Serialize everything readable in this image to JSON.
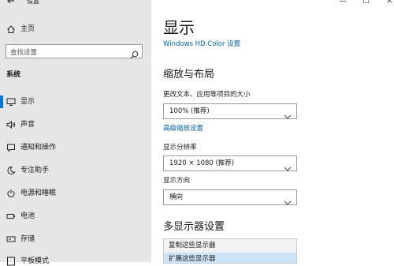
{
  "window": {
    "title": "设置",
    "controls": {
      "minimize": "—",
      "maximize": "☐",
      "close": "✕"
    }
  },
  "sidebar": {
    "home": "主页",
    "search_placeholder": "查找设置",
    "section": "系统",
    "items": [
      {
        "label": "显示",
        "icon": "monitor-icon",
        "selected": true
      },
      {
        "label": "声音",
        "icon": "speaker-icon"
      },
      {
        "label": "通知和操作",
        "icon": "notification-icon"
      },
      {
        "label": "专注助手",
        "icon": "moon-icon"
      },
      {
        "label": "电源和睡眠",
        "icon": "power-icon"
      },
      {
        "label": "电池",
        "icon": "battery-icon"
      },
      {
        "label": "存储",
        "icon": "storage-icon"
      },
      {
        "label": "平板模式",
        "icon": "tablet-icon"
      }
    ]
  },
  "main": {
    "title": "显示",
    "hdr_link": "Windows HD Color 设置",
    "scale_heading": "缩放与布局",
    "scale_label": "更改文本、应用等项目的大小",
    "scale_value": "100% (推荐)",
    "advanced_link": "高级缩放设置",
    "resolution_label": "显示分辨率",
    "resolution_value": "1920 × 1080 (推荐)",
    "orientation_label": "显示方向",
    "orientation_value": "横向",
    "multi_heading": "多显示器设置",
    "multi_options": [
      "复制这些显示器",
      "扩展这些显示器"
    ]
  },
  "colors": {
    "accent": "#0078d7",
    "link": "#0063b1",
    "sidebar_bg": "#e6e6e6"
  }
}
